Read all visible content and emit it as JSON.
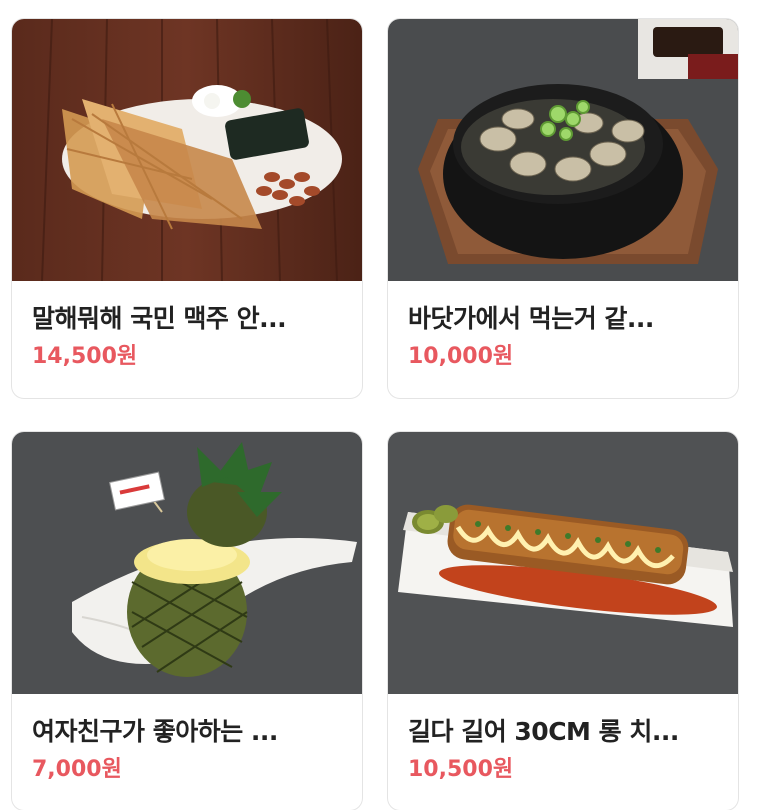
{
  "menu_items": [
    {
      "name": "말해뭐해 국민 맥주 안...",
      "price": "14,500원",
      "image": "dried-pollock-snack-platter"
    },
    {
      "name": "바닷가에서 먹는거 같...",
      "price": "10,000원",
      "image": "clam-soup-black-pot"
    },
    {
      "name": "여자친구가 좋아하는 ...",
      "price": "7,000원",
      "image": "pineapple-sorbet-plate"
    },
    {
      "name": "길다 길어 30CM 롱 치...",
      "price": "10,500원",
      "image": "long-cutlet-with-mayo"
    }
  ],
  "colors": {
    "price": "#e8585f",
    "name": "#222222",
    "card_border": "#e4e4e4"
  }
}
